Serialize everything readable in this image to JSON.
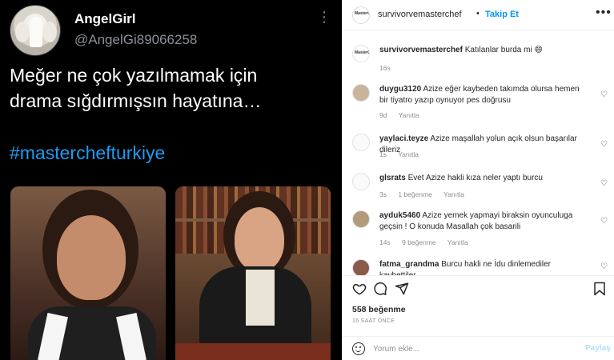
{
  "tweet": {
    "name": "AngelGirl",
    "handle": "@AngelGi89066258",
    "text_line1": "Meğer ne çok yazılmamak için",
    "text_line2": "drama sığdırmışsın hayatına…",
    "hashtag": "#masterchefturkiye"
  },
  "header": {
    "username": "survivorvemasterchef",
    "dot": "•",
    "follow_label": "Takip Et",
    "avatar_logo": "MasterChef"
  },
  "caption": {
    "username": "survivorvemasterchef",
    "text": "Katılanlar burda mi 😄",
    "time": "16s"
  },
  "comments": [
    {
      "username": "duygu3120",
      "text": "Azize eğer kaybeden takımda olursa hemen bir tiyatro yazıp oynuyor pes doğrusu",
      "time": "9d",
      "likes": "",
      "reply": "Yanıtla"
    },
    {
      "username": "yaylaci.teyze",
      "text": "Azize maşallah yolun açık olsun başarılar dileriz",
      "time": "1s",
      "likes": "",
      "reply": "Yanıtla"
    },
    {
      "username": "glsrats",
      "text": "Evet Azize hakli kıza neler yaptı burcu",
      "time": "3s",
      "likes": "1 beğenme",
      "reply": "Yanıtla"
    },
    {
      "username": "ayduk5460",
      "text": "Azize yemek yapmayi biraksin oyunculuga geçsin ! O konuda Masallah çok basarili",
      "time": "14s",
      "likes": "9 beğenme",
      "reply": "Yanıtla"
    },
    {
      "username": "fatma_grandma",
      "text": "Burcu hakli ne İdu dinlemediler kaybettiler",
      "time": "",
      "likes": "",
      "reply": ""
    }
  ],
  "likes_count": "558 beğenme",
  "posted_ago": "16 SAAT ÖNCE",
  "comment_input": {
    "placeholder": "Yorum ekle..."
  },
  "post_button": "Paylaş",
  "icons": {
    "heart": "heart-icon",
    "comment": "comment-icon",
    "share": "share-icon",
    "save": "bookmark-icon",
    "more": "more-icon",
    "emoji": "emoji-icon"
  },
  "colors": {
    "link_blue": "#0095f6",
    "tweet_bg": "#000000",
    "hashtag": "#1d9bf0"
  }
}
